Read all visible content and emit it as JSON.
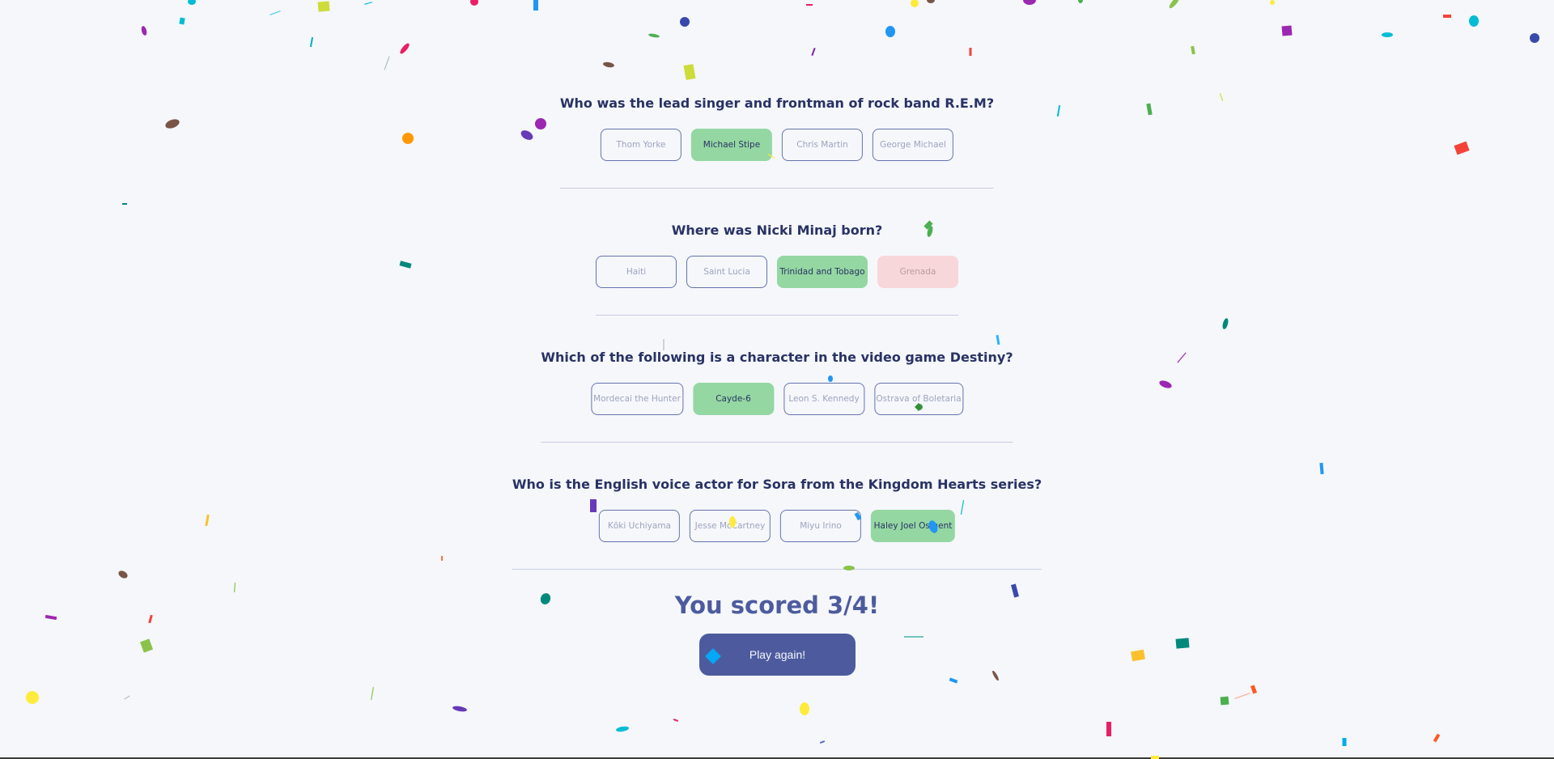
{
  "questions": [
    {
      "text": "Who was the lead singer and frontman of rock band R.E.M?",
      "answers": [
        {
          "label": "Thom Yorke",
          "state": "neutral"
        },
        {
          "label": "Michael Stipe",
          "state": "correct"
        },
        {
          "label": "Chris Martin",
          "state": "neutral"
        },
        {
          "label": "George Michael",
          "state": "neutral"
        }
      ]
    },
    {
      "text": "Where was Nicki Minaj born?",
      "answers": [
        {
          "label": "Haiti",
          "state": "neutral"
        },
        {
          "label": "Saint Lucia",
          "state": "neutral"
        },
        {
          "label": "Trinidad and Tobago",
          "state": "correct"
        },
        {
          "label": "Grenada",
          "state": "wrong"
        }
      ]
    },
    {
      "text": "Which of the following is a character in the video game Destiny?",
      "answers": [
        {
          "label": "Mordecai the Hunter",
          "state": "neutral"
        },
        {
          "label": "Cayde-6",
          "state": "correct"
        },
        {
          "label": "Leon S. Kennedy",
          "state": "neutral"
        },
        {
          "label": "Ostrava of Boletaria",
          "state": "neutral"
        }
      ]
    },
    {
      "text": "Who is the English voice actor for Sora from the Kingdom Hearts series?",
      "answers": [
        {
          "label": "Kōki Uchiyama",
          "state": "neutral"
        },
        {
          "label": "Jesse McCartney",
          "state": "neutral"
        },
        {
          "label": "Miyu Irino",
          "state": "neutral"
        },
        {
          "label": "Haley Joel Osment",
          "state": "correct"
        }
      ]
    }
  ],
  "result": {
    "score_text": "You scored 3/4!",
    "play_again_label": "Play again!"
  },
  "colors": {
    "background": "#f5f7fb",
    "text": "#293264",
    "accent": "#4d5b9e",
    "correct": "#94d7a2",
    "wrong": "#f8d7da"
  }
}
